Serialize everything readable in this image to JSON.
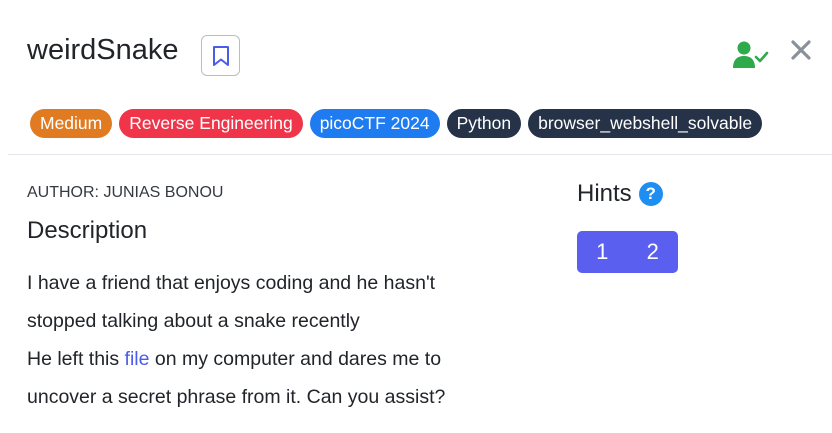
{
  "challenge": {
    "title": "weirdSnake",
    "tags": [
      {
        "label": "Medium",
        "color": "#e07b22"
      },
      {
        "label": "Reverse Engineering",
        "color": "#f0354a"
      },
      {
        "label": "picoCTF 2024",
        "color": "#1f7cf0"
      },
      {
        "label": "Python",
        "color": "#263248"
      },
      {
        "label": "browser_webshell_solvable",
        "color": "#263248"
      }
    ],
    "author": "AUTHOR: JUNIAS BONOU",
    "description_heading": "Description",
    "description": {
      "line1": "I have a friend that enjoys coding and he hasn't stopped talking about a snake recently",
      "line2_before": "He left this ",
      "link_text": "file",
      "line2_after": " on my computer and dares me to uncover a secret phrase from it. Can you assist?"
    }
  },
  "hints": {
    "heading": "Hints",
    "help_glyph": "?",
    "buttons": [
      "1",
      "2"
    ]
  },
  "icons": {
    "bookmark": "bookmark-icon",
    "user_check": "user-check-icon",
    "close": "close-icon"
  },
  "colors": {
    "accent": "#5a5ff0",
    "solved_green": "#2eaa4a",
    "link": "#4a5ce8"
  }
}
